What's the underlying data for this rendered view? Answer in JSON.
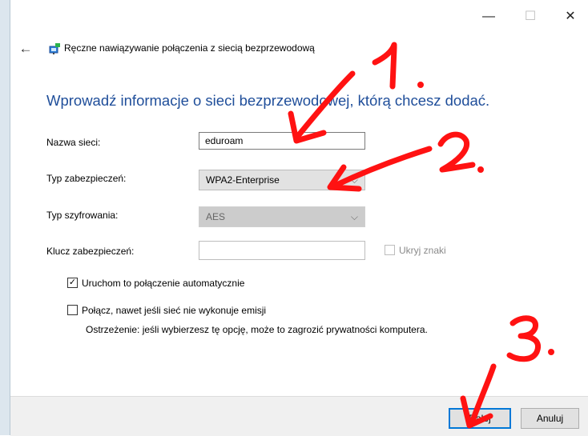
{
  "window": {
    "title": "Ręczne nawiązywanie połączenia z siecią bezprzewodową",
    "minimize_icon": "minimize-icon",
    "maximize_icon": "maximize-icon",
    "close_icon": "close-icon"
  },
  "main": {
    "heading": "Wprowadź informacje o sieci bezprzewodowej, którą chcesz dodać.",
    "fields": {
      "network_name_label": "Nazwa sieci:",
      "network_name_value": "eduroam",
      "security_type_label": "Typ zabezpieczeń:",
      "security_type_value": "WPA2-Enterprise",
      "encryption_type_label": "Typ szyfrowania:",
      "encryption_type_value": "AES",
      "security_key_label": "Klucz zabezpieczeń:",
      "security_key_value": "",
      "hide_chars_label": "Ukryj znaki"
    },
    "options": {
      "auto_connect_label": "Uruchom to połączenie automatycznie",
      "auto_connect_checked": true,
      "connect_hidden_label": "Połącz, nawet jeśli sieć nie wykonuje emisji",
      "connect_hidden_checked": false,
      "warning_text": "Ostrzeżenie: jeśli wybierzesz tę opcję, może to zagrozić prywatności komputera."
    }
  },
  "footer": {
    "next_label": "Dalej",
    "cancel_label": "Anuluj"
  },
  "annotations": {
    "step1": "1.",
    "step2": "2.",
    "step3": "3.",
    "color": "#ff0000"
  },
  "icons": {
    "back": "back-arrow-icon",
    "network": "network-icon",
    "chevron": "chevron-down-icon",
    "check": "check-icon"
  },
  "colors": {
    "heading": "#1f4e9a",
    "primary_button_border": "#0078d7"
  }
}
